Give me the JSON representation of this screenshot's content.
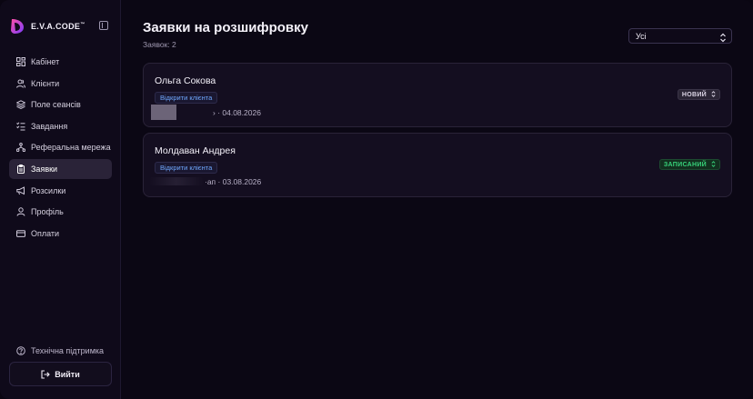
{
  "app": {
    "brand": "E.V.A.CODE",
    "brand_mark": "™"
  },
  "sidebar": {
    "items": [
      {
        "label": "Кабінет",
        "icon": "dashboard-icon"
      },
      {
        "label": "Клієнти",
        "icon": "users-icon"
      },
      {
        "label": "Поле сеансів",
        "icon": "layers-icon"
      },
      {
        "label": "Завдання",
        "icon": "tasks-icon"
      },
      {
        "label": "Реферальна мережа",
        "icon": "network-icon"
      },
      {
        "label": "Заявки",
        "icon": "clipboard-icon",
        "active": true
      },
      {
        "label": "Розсилки",
        "icon": "megaphone-icon"
      },
      {
        "label": "Профіль",
        "icon": "user-icon"
      },
      {
        "label": "Оплати",
        "icon": "card-icon"
      }
    ],
    "support_label": "Технічна підтримка",
    "logout_label": "Вийти"
  },
  "main": {
    "title": "Заявки на розшифровку",
    "count_text": "Заявок: 2",
    "filter": {
      "selected": "Усі"
    },
    "requests": [
      {
        "name": "Ольга Сокова",
        "open_label": "Відкрити клієнта",
        "meta_suffix": "› · 04.08.2026",
        "status": "НОВИЙ"
      },
      {
        "name": "Молдаван Андрея",
        "open_label": "Відкрити клієнта",
        "meta_suffix": "·ап · 03.08.2026",
        "status": "ЗАПИСАНИЙ"
      }
    ]
  },
  "colors": {
    "background": "#0b0714",
    "sidebar": "#0f0a1a",
    "active_item": "#2a2338",
    "link": "#6fa8ff",
    "status_booked": "#37d27a"
  }
}
